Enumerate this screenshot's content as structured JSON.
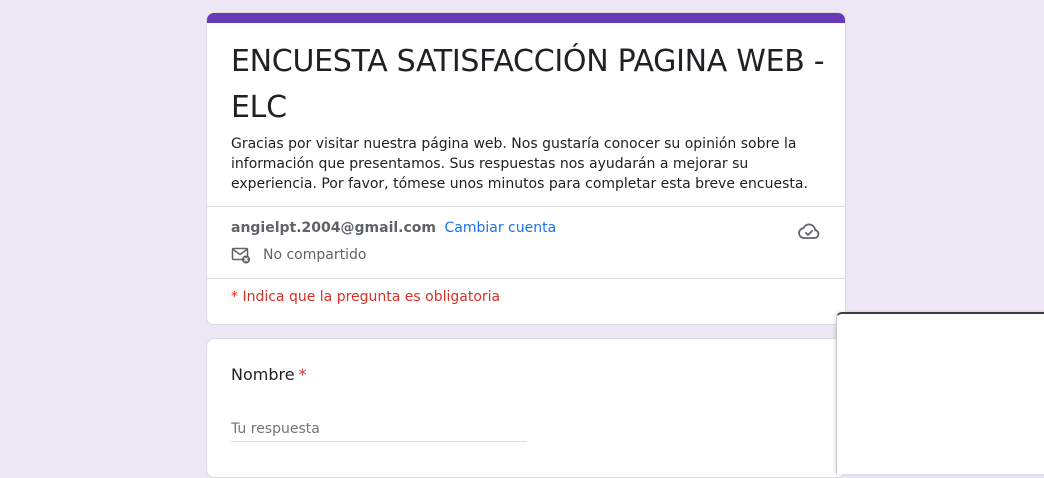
{
  "form": {
    "title": "ENCUESTA SATISFACCIÓN PAGINA WEB - ELC",
    "description": "Gracias por visitar nuestra página web. Nos gustaría conocer su opinión sobre la información que presentamos. Sus respuestas nos ayudarán a mejorar su experiencia. Por favor, tómese unos minutos para completar esta breve encuesta.",
    "accent_color": "#673ab7"
  },
  "account": {
    "email": "angielpt.2004@gmail.com",
    "switch_label": "Cambiar cuenta",
    "share_status": "No compartido",
    "share_icon": "mail-not-shared-icon",
    "cloud_icon": "cloud-saved-icon"
  },
  "required_note": "* Indica que la pregunta es obligatoria",
  "questions": [
    {
      "label": "Nombre",
      "required_mark": "*",
      "placeholder": "Tu respuesta",
      "value": ""
    }
  ]
}
